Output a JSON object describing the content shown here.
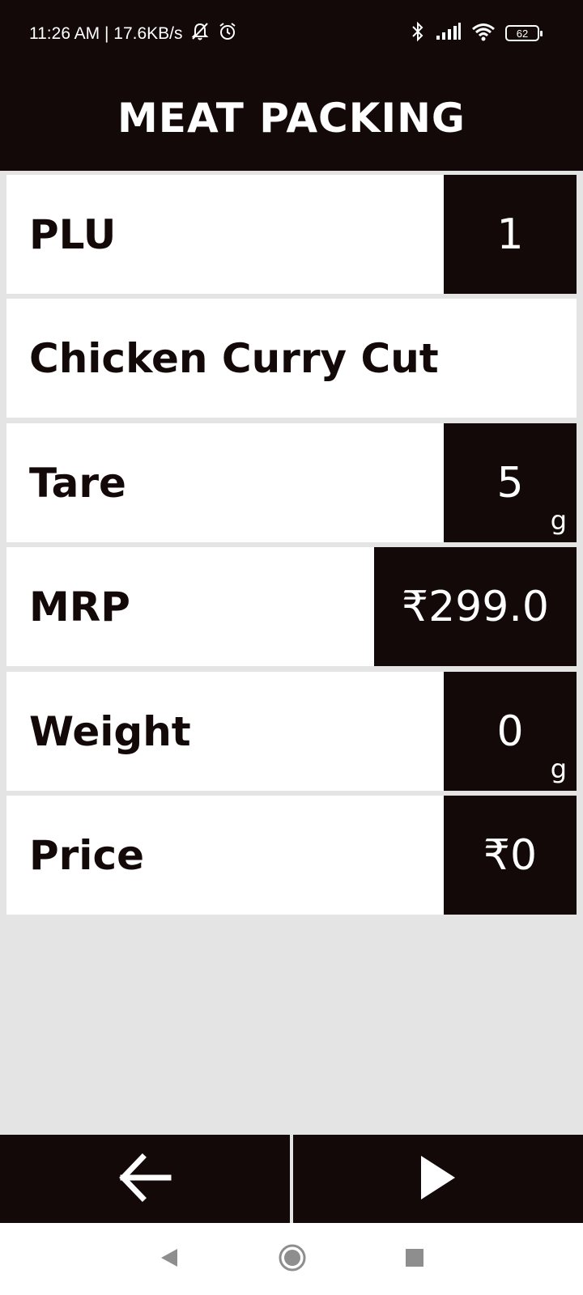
{
  "status_bar": {
    "time_and_speed": "11:26 AM | 17.6KB/s",
    "battery_level": "62",
    "icons": [
      "bell-off-icon",
      "alarm-icon",
      "bluetooth-icon",
      "signal-icon",
      "wifi-icon",
      "battery-icon"
    ]
  },
  "header": {
    "title": "MEAT PACKING"
  },
  "rows": {
    "plu": {
      "label": "PLU",
      "value": "1"
    },
    "product": {
      "name": "Chicken Curry Cut"
    },
    "tare": {
      "label": "Tare",
      "value": "5",
      "unit": "g"
    },
    "mrp": {
      "label": "MRP",
      "value": "₹299.0"
    },
    "weight": {
      "label": "Weight",
      "value": "0",
      "unit": "g"
    },
    "price": {
      "label": "Price",
      "value": "₹0"
    }
  },
  "actions": {
    "back_icon": "arrow-left-icon",
    "next_icon": "play-icon"
  },
  "nav": {
    "icons": [
      "nav-back-icon",
      "nav-home-icon",
      "nav-recents-icon"
    ]
  },
  "colors": {
    "dark": "#140909",
    "background": "#e4e4e4",
    "row": "#ffffff"
  }
}
